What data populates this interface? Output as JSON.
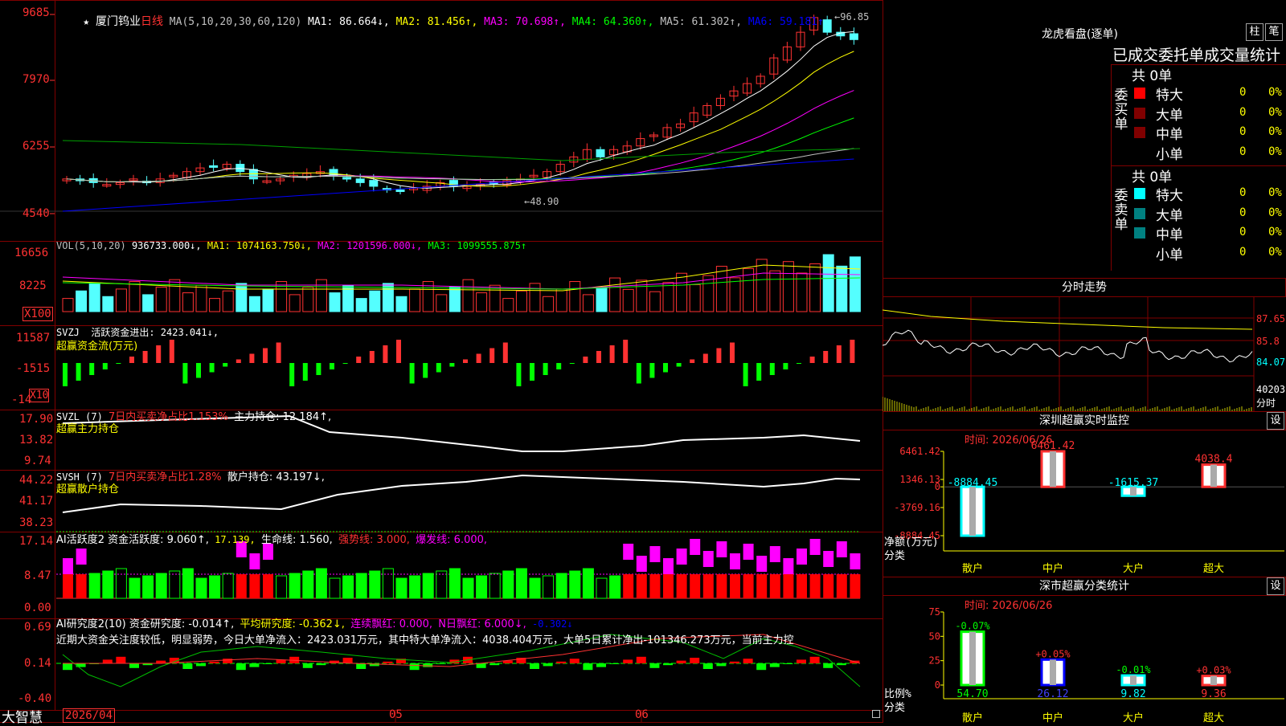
{
  "stock": {
    "name": "厦门钨业",
    "period": "日线",
    "star": "★"
  },
  "ma_line": {
    "label": "MA(5,10,20,30,60,120)",
    "ma1": "MA1: 86.664↓,",
    "ma2": "MA2: 81.456↑,",
    "ma3": "MA3: 70.698↑,",
    "ma4": "MA4: 64.360↑,",
    "ma5": "MA5: 61.302↑,",
    "ma6": "MA6: 59.181↑"
  },
  "price_axis": [
    "9685",
    "7970",
    "6255",
    "4540"
  ],
  "price_marks": {
    "high": "96.85",
    "low": "48.90"
  },
  "vol_line": {
    "label": "VOL(5,10,20)",
    "val": "936733.000↓,",
    "ma1": "MA1: 1074163.750↓,",
    "ma2": "MA2: 1201596.000↓,",
    "ma3": "MA3: 1099555.875↑"
  },
  "vol_axis": [
    "16656",
    "8225",
    "X100"
  ],
  "svzj": {
    "label": "SVZJ  活跃资金进出: 2423.041↓,",
    "sub": "超赢资金流(万元)",
    "axis": [
      "11587",
      "-1515",
      "-14",
      "X10"
    ]
  },
  "svzl": {
    "label": "SVZL (7)",
    "a": "7日内买卖净占比1.153%",
    "b": "主力持仓: 12.184↑,",
    "sub": "超赢主力持仓",
    "axis": [
      "17.90",
      "13.82",
      "9.74"
    ]
  },
  "svsh": {
    "label": "SVSH (7)",
    "a": "7日内买卖净占比1.28%",
    "b": "散户持仓: 43.197↓,",
    "sub": "超赢散户持仓",
    "axis": [
      "44.22",
      "41.17",
      "38.23"
    ]
  },
  "ai1": {
    "label": "AI活跃度2 资金活跃度: 9.060↑,",
    "v2": "17.139,",
    "v3": "生命线: 1.560,",
    "v4": "强势线: 3.000,",
    "v5": "爆发线: 6.000,",
    "axis": [
      "17.14",
      "8.47",
      "0.00"
    ]
  },
  "ai2": {
    "label": "AI研究度2(10) 资金研究度: -0.014↑,",
    "v2": "平均研究度: -0.362↓,",
    "v3": "连续飘红: 0.000,",
    "v4": "N日飘红: 6.000↓,",
    "v5": "-0.302↓",
    "axis": [
      "0.69",
      "0.14",
      "-0.40"
    ],
    "comment": "近期大资金关注度较低，明显弱势，今日大单净流入：2423.031万元，其中特大单净流入：4038.404万元，大单5日累计净出-101346.273万元，当前主力控"
  },
  "bottom": {
    "brand": "大智慧",
    "date": "2026/04",
    "m05": "05",
    "m06": "06"
  },
  "lhk": {
    "title": "龙虎看盘(逐单)",
    "btn1": "柱",
    "btn2": "笔",
    "header": "已成交委托单成交量统计",
    "buy": {
      "vlabel": "委买单",
      "total": "共 0单",
      "rows": [
        {
          "name": "特大",
          "v": "0",
          "p": "0%",
          "c": "#ff0000"
        },
        {
          "name": "大单",
          "v": "0",
          "p": "0%",
          "c": "#800000"
        },
        {
          "name": "中单",
          "v": "0",
          "p": "0%",
          "c": "#800000"
        },
        {
          "name": "小单",
          "v": "0",
          "p": "0%",
          "c": ""
        }
      ]
    },
    "sell": {
      "vlabel": "委卖单",
      "total": "共 0单",
      "rows": [
        {
          "name": "特大",
          "v": "0",
          "p": "0%",
          "c": "#00ffff"
        },
        {
          "name": "大单",
          "v": "0",
          "p": "0%",
          "c": "#008080"
        },
        {
          "name": "中单",
          "v": "0",
          "p": "0%",
          "c": "#008080"
        },
        {
          "name": "小单",
          "v": "0",
          "p": "0%",
          "c": ""
        }
      ]
    }
  },
  "fs": {
    "title": "分时走势",
    "axis": [
      "87.65",
      "85.8",
      "84.07",
      "40203",
      "分时"
    ]
  },
  "szcy": {
    "title": "深圳超赢实时监控",
    "btn": "设",
    "time": "时间: 2026/06/26",
    "axis": [
      "6461.42",
      "1346.13",
      "0",
      "-3769.16",
      "-8884.45"
    ],
    "ylabel": "净额(万元)",
    "xlabel": "分类",
    "bars": [
      {
        "cat": "散户",
        "v": -8884.45,
        "label": "-8884.45"
      },
      {
        "cat": "中户",
        "v": 6461.42,
        "label": "6461.42"
      },
      {
        "cat": "大户",
        "v": -1615.37,
        "label": "-1615.37"
      },
      {
        "cat": "超大",
        "v": 4038.4,
        "label": "4038.4"
      }
    ]
  },
  "scfl": {
    "title": "深市超赢分类统计",
    "btn": "设",
    "time": "时间: 2026/06/26",
    "axis": [
      "75",
      "50",
      "25",
      "0"
    ],
    "ylabel": "比例%",
    "xlabel": "分类",
    "bars": [
      {
        "cat": "散户",
        "v": 54.7,
        "label": "54.70",
        "chg": "-0.07%",
        "col": "#00ff00"
      },
      {
        "cat": "中户",
        "v": 26.12,
        "label": "26.12",
        "chg": "+0.05%",
        "col": "#0000ff"
      },
      {
        "cat": "大户",
        "v": 9.82,
        "label": "9.82",
        "chg": "-0.01%",
        "col": "#00ffff"
      },
      {
        "cat": "超大",
        "v": 9.36,
        "label": "9.36",
        "chg": "+0.03%",
        "col": "#ff3030"
      }
    ]
  },
  "colors": {
    "up": "#ff3232",
    "down": "#54ffff",
    "ma1": "#ffffff",
    "ma2": "#ffff00",
    "ma3": "#ff00ff",
    "ma4": "#00ff00",
    "ma5": "#c0c0c0",
    "ma6": "#0000ff",
    "grid": "#800000"
  }
}
